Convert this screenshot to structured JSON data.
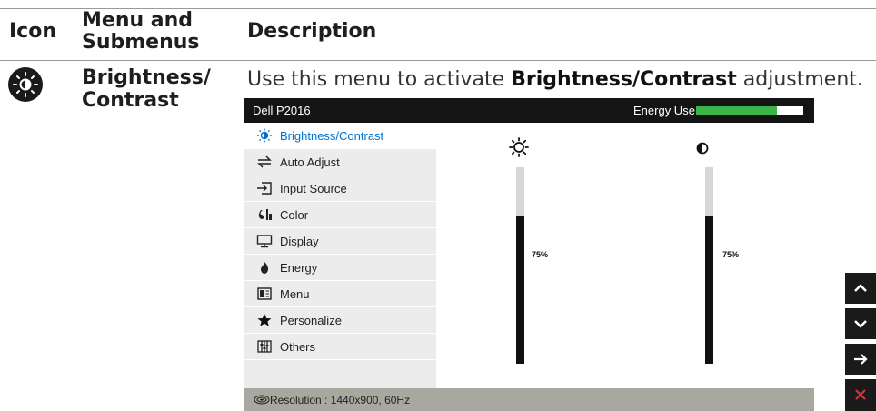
{
  "header": {
    "col_icon": "Icon",
    "col_menu": "Menu and Submenus",
    "col_description": "Description"
  },
  "row": {
    "icon": "brightness-contrast-icon",
    "menu_name": "Brightness/ Contrast",
    "description_prefix": "Use this menu to activate ",
    "description_bold": "Brightness/Contrast",
    "description_suffix": " adjustment."
  },
  "osd": {
    "model": "Dell P2016",
    "energy_label": "Energy Use",
    "energy_level": 0.75,
    "menu_items": [
      {
        "label": "Brightness/Contrast",
        "icon": "brightness-contrast-icon",
        "selected": true
      },
      {
        "label": "Auto Adjust",
        "icon": "auto-adjust-icon",
        "selected": false
      },
      {
        "label": "Input Source",
        "icon": "input-source-icon",
        "selected": false
      },
      {
        "label": "Color",
        "icon": "color-icon",
        "selected": false
      },
      {
        "label": "Display",
        "icon": "display-icon",
        "selected": false
      },
      {
        "label": "Energy",
        "icon": "energy-icon",
        "selected": false
      },
      {
        "label": "Menu",
        "icon": "menu-icon",
        "selected": false
      },
      {
        "label": "Personalize",
        "icon": "personalize-icon",
        "selected": false
      },
      {
        "label": "Others",
        "icon": "others-icon",
        "selected": false
      }
    ],
    "brightness": {
      "icon": "sun-icon",
      "label": "75%",
      "value": 75
    },
    "contrast": {
      "icon": "contrast-icon",
      "label": "75%",
      "value": 75
    },
    "status": "Resolution : 1440x900, 60Hz"
  },
  "nav_buttons": [
    "up-arrow-icon",
    "down-arrow-icon",
    "right-arrow-icon",
    "close-icon"
  ],
  "colors": {
    "selected_text": "#0072ce",
    "energy_fill": "#3bb44a",
    "close_red": "#e0312f"
  }
}
